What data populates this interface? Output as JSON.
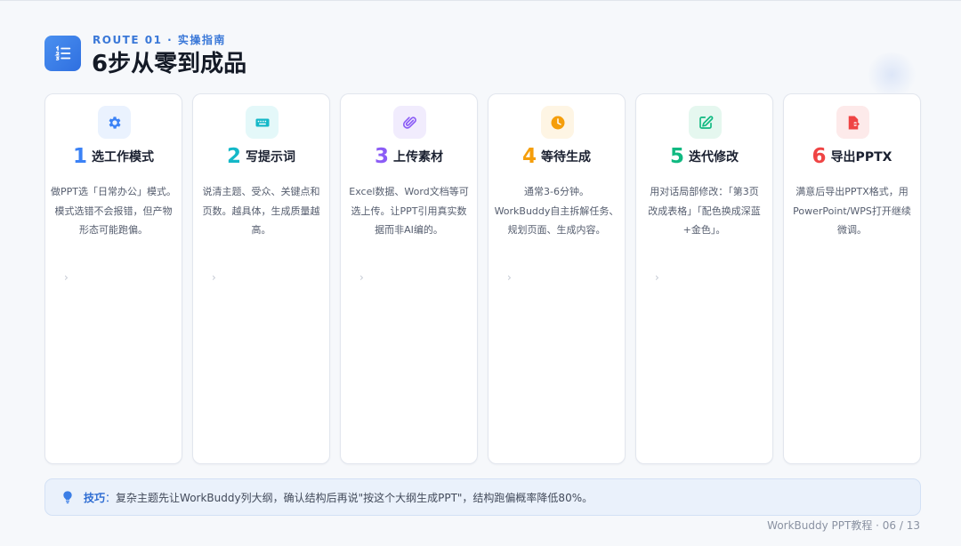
{
  "header": {
    "kicker": "ROUTE 01 · 实操指南",
    "title": "6步从零到成品"
  },
  "steps": [
    {
      "number": "1",
      "title": "选工作模式",
      "icon": "gear-icon",
      "color": "#3b82f6",
      "tint": "#eaf2fe",
      "lines": [
        "做PPT选「日常办公」模式。",
        "模式选错不会报错，但产物",
        "形态可能跑偏。"
      ]
    },
    {
      "number": "2",
      "title": "写提示词",
      "icon": "keyboard-icon",
      "color": "#14b8c8",
      "tint": "#e4f8f9",
      "lines": [
        "说清主题、受众、关键点和",
        "页数。越具体，生成质量越",
        "高。"
      ]
    },
    {
      "number": "3",
      "title": "上传素材",
      "icon": "paperclip-icon",
      "color": "#8b5cf6",
      "tint": "#f1ecfd",
      "lines": [
        "Excel数据、Word文档等可",
        "选上传。让PPT引用真实数",
        "据而非AI编的。"
      ]
    },
    {
      "number": "4",
      "title": "等待生成",
      "icon": "clock-icon",
      "color": "#f59e0b",
      "tint": "#fef5e4",
      "lines": [
        "通常3-6分钟。",
        "WorkBuddy自主拆解任务、",
        "规划页面、生成内容。"
      ]
    },
    {
      "number": "5",
      "title": "迭代修改",
      "icon": "edit-icon",
      "color": "#10b981",
      "tint": "#e5f7ef",
      "lines": [
        "用对话局部修改：「第3页",
        "改成表格」「配色换成深蓝",
        "+金色」。"
      ]
    },
    {
      "number": "6",
      "title": "导出PPTX",
      "icon": "file-export-icon",
      "color": "#ef4444",
      "tint": "#fdeaea",
      "lines": [
        "满意后导出PPTX格式，用",
        "PowerPoint/WPS打开继续",
        "微调。"
      ]
    }
  ],
  "chevron": "›",
  "tip": {
    "label": "技巧",
    "separator": "：",
    "text": "复杂主题先让WorkBuddy列大纲，确认结构后再说\"按这个大纲生成PPT\"，结构跑偏概率降低80%。"
  },
  "footer": {
    "text": "WorkBuddy PPT教程 · 06 / 13"
  }
}
